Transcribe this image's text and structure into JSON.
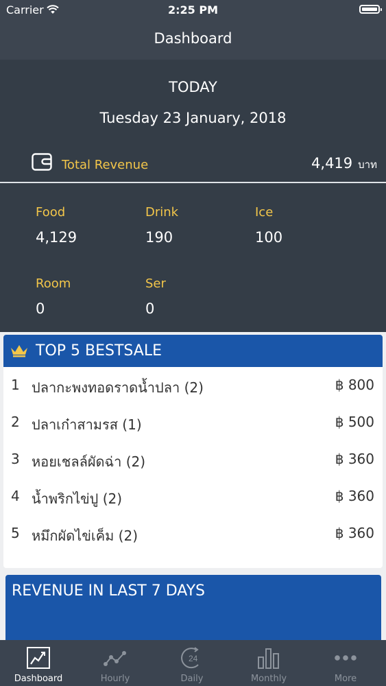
{
  "status_bar": {
    "carrier": "Carrier",
    "time": "2:25 PM"
  },
  "nav": {
    "title": "Dashboard"
  },
  "summary": {
    "heading": "TODAY",
    "date": "Tuesday 23 January, 2018",
    "total_label": "Total Revenue",
    "total_value": "4,419",
    "total_unit": "บาท",
    "categories": [
      {
        "label": "Food",
        "value": "4,129"
      },
      {
        "label": "Drink",
        "value": "190"
      },
      {
        "label": "Ice",
        "value": "100"
      },
      {
        "label": "Room",
        "value": "0"
      },
      {
        "label": "Ser",
        "value": "0"
      }
    ]
  },
  "bestsale": {
    "title": "TOP 5 BESTSALE",
    "items": [
      {
        "rank": "1",
        "name": "ปลากะพงทอดราดน้ำปลา (2)",
        "price": "฿ 800"
      },
      {
        "rank": "2",
        "name": "ปลาเก๋าสามรส (1)",
        "price": "฿ 500"
      },
      {
        "rank": "3",
        "name": "หอยเชลล์ผัดฉ่า (2)",
        "price": "฿ 360"
      },
      {
        "rank": "4",
        "name": "น้ำพริกไข่ปู (2)",
        "price": "฿ 360"
      },
      {
        "rank": "5",
        "name": "หมึกผัดไข่เค็ม (2)",
        "price": "฿ 360"
      }
    ]
  },
  "revenue_chart": {
    "title": "REVENUE IN LAST 7 DAYS"
  },
  "tabbar": {
    "tabs": [
      {
        "label": "Dashboard",
        "icon": "line-chart-icon",
        "active": true
      },
      {
        "label": "Hourly",
        "icon": "scatter-line-icon",
        "active": false
      },
      {
        "label": "Daily",
        "icon": "clock-24-icon",
        "active": false
      },
      {
        "label": "Monthly",
        "icon": "bar-chart-icon",
        "active": false
      },
      {
        "label": "More",
        "icon": "more-dots-icon",
        "active": false
      }
    ]
  },
  "colors": {
    "nav_bg": "#3d4550",
    "panel_bg": "#343d47",
    "accent_yellow": "#f3c64a",
    "card_blue": "#1a56a9",
    "tabbar_bg": "#3b4450",
    "tab_inactive": "#8c939c"
  }
}
